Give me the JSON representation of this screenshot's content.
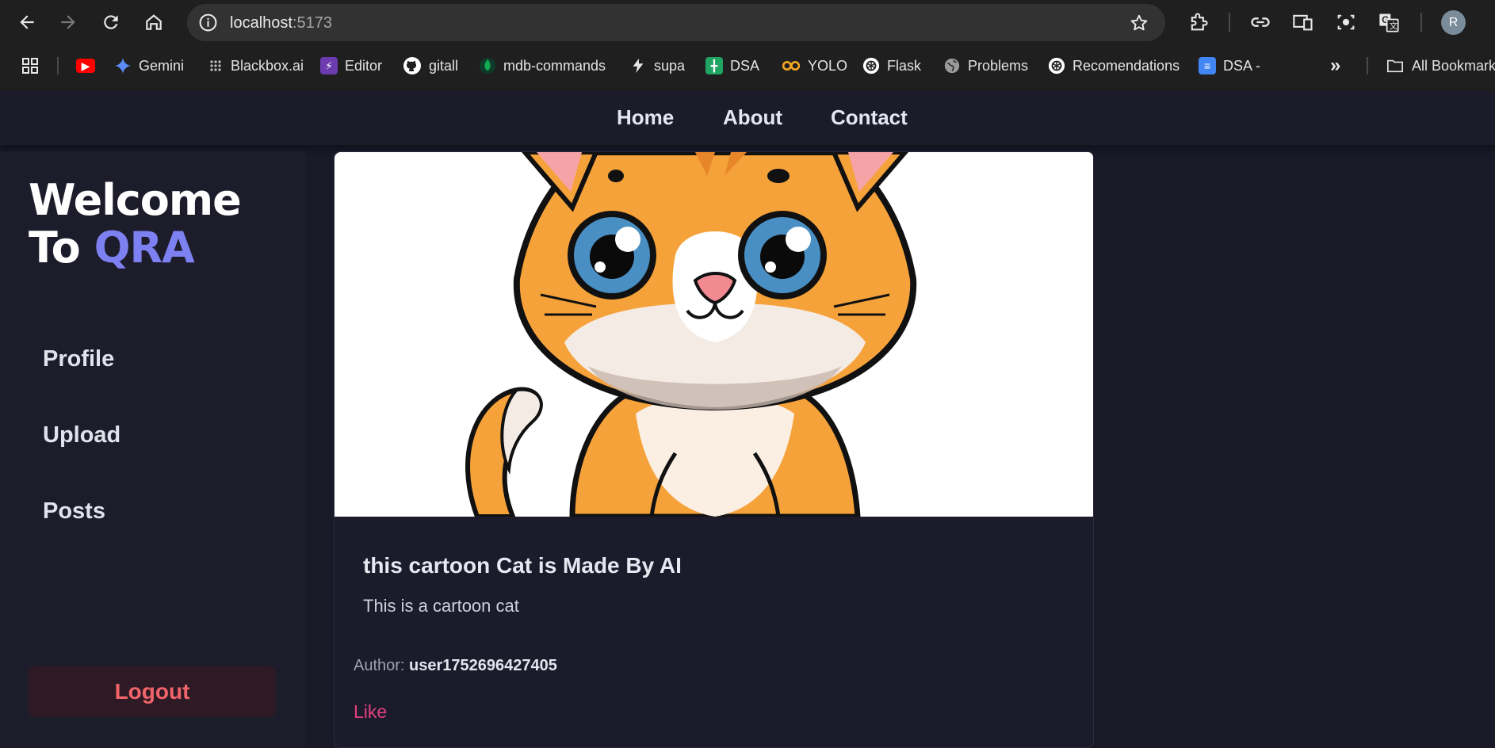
{
  "browser": {
    "url_host": "localhost",
    "url_port": ":5173",
    "avatar_letter": "R",
    "bookmarks": [
      {
        "label": "",
        "icon": "youtube-icon",
        "color": "#ff0000"
      },
      {
        "label": "Gemini",
        "icon": "gemini-icon",
        "color": "#4a8cf5"
      },
      {
        "label": "Blackbox.ai",
        "icon": "blackbox-icon",
        "color": "#333333"
      },
      {
        "label": "Editor",
        "icon": "editor-icon",
        "color": "#6c3bb0"
      },
      {
        "label": "gitall",
        "icon": "github-icon",
        "color": "#ffffff"
      },
      {
        "label": "mdb-commands",
        "icon": "mongodb-icon",
        "color": "#13aa52"
      },
      {
        "label": "supa",
        "icon": "supa-icon",
        "color": "#ffffff"
      },
      {
        "label": "DSA",
        "icon": "sheets-icon",
        "color": "#1fa463"
      },
      {
        "label": "YOLO",
        "icon": "yolo-icon",
        "color": "#f5a623"
      },
      {
        "label": "Flask",
        "icon": "chatgpt-icon",
        "color": "#ffffff"
      },
      {
        "label": "Problems",
        "icon": "globe-icon",
        "color": "#9a9a9a"
      },
      {
        "label": "Recomendations",
        "icon": "chatgpt-icon",
        "color": "#ffffff"
      },
      {
        "label": "DSA -",
        "icon": "docs-icon",
        "color": "#4285f4"
      }
    ],
    "all_bookmarks_label": "All Bookmarks"
  },
  "topnav": {
    "home": "Home",
    "about": "About",
    "contact": "Contact"
  },
  "sidebar": {
    "welcome_line1": "Welcome",
    "welcome_line2_prefix": "To ",
    "welcome_brand": "QRA",
    "items": [
      "Profile",
      "Upload",
      "Posts"
    ],
    "logout": "Logout"
  },
  "post": {
    "title": "this cartoon Cat is Made By AI",
    "description": "This is a cartoon cat",
    "author_label": "Author:",
    "author": "user1752696427405",
    "like": "Like",
    "image": "cartoon-cat-image"
  },
  "colors": {
    "brand_accent": "#7d80f0",
    "logout_text": "#f0646a",
    "like_text": "#e0407c",
    "page_bg": "#191927"
  }
}
